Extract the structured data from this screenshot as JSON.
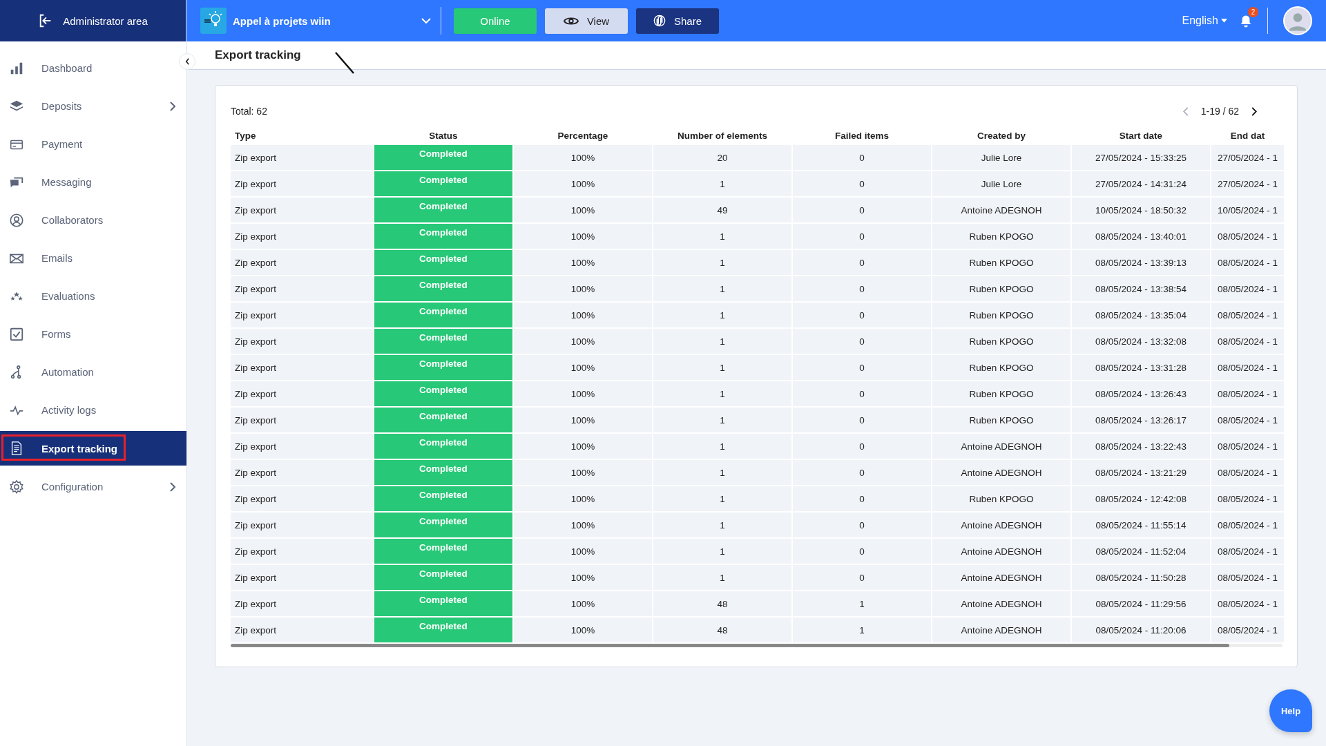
{
  "topbar": {
    "admin_label": "Administrator area",
    "project": {
      "name": "Appel à projets wiin"
    },
    "buttons": [
      {
        "label": "Online",
        "kind": "online"
      },
      {
        "label": "View",
        "kind": "view"
      },
      {
        "label": "Share",
        "kind": "share"
      }
    ],
    "language": "English",
    "notifications": "2"
  },
  "sidebar": {
    "items": [
      {
        "label": "Dashboard",
        "selected": false,
        "submenu": false
      },
      {
        "label": "Deposits",
        "selected": false,
        "submenu": true
      },
      {
        "label": "Payment",
        "selected": false,
        "submenu": false
      },
      {
        "label": "Messaging",
        "selected": false,
        "submenu": false
      },
      {
        "label": "Collaborators",
        "selected": false,
        "submenu": false
      },
      {
        "label": "Emails",
        "selected": false,
        "submenu": false
      },
      {
        "label": "Evaluations",
        "selected": false,
        "submenu": false
      },
      {
        "label": "Forms",
        "selected": false,
        "submenu": false
      },
      {
        "label": "Automation",
        "selected": false,
        "submenu": false
      },
      {
        "label": "Activity logs",
        "selected": false,
        "submenu": false
      },
      {
        "label": "Export tracking",
        "selected": true,
        "submenu": false
      },
      {
        "label": "Configuration",
        "selected": false,
        "submenu": true
      }
    ]
  },
  "page_title": "Export tracking",
  "total": "Total: 62",
  "pagination": "1-19 / 62",
  "help": "Help",
  "table": {
    "columns": [
      "Type",
      "Status",
      "Percentage",
      "Number of elements",
      "Failed items",
      "Created by",
      "Start date",
      "End dat"
    ],
    "rows": [
      [
        "Zip export",
        "Completed",
        "100%",
        "20",
        "0",
        "Julie Lore",
        "27/05/2024 - 15:33:25",
        "27/05/2024 - 1"
      ],
      [
        "Zip export",
        "Completed",
        "100%",
        "1",
        "0",
        "Julie Lore",
        "27/05/2024 - 14:31:24",
        "27/05/2024 - 1"
      ],
      [
        "Zip export",
        "Completed",
        "100%",
        "49",
        "0",
        "Antoine ADEGNOH",
        "10/05/2024 - 18:50:32",
        "10/05/2024 - 1"
      ],
      [
        "Zip export",
        "Completed",
        "100%",
        "1",
        "0",
        "Ruben KPOGO",
        "08/05/2024 - 13:40:01",
        "08/05/2024 - 1"
      ],
      [
        "Zip export",
        "Completed",
        "100%",
        "1",
        "0",
        "Ruben KPOGO",
        "08/05/2024 - 13:39:13",
        "08/05/2024 - 1"
      ],
      [
        "Zip export",
        "Completed",
        "100%",
        "1",
        "0",
        "Ruben KPOGO",
        "08/05/2024 - 13:38:54",
        "08/05/2024 - 1"
      ],
      [
        "Zip export",
        "Completed",
        "100%",
        "1",
        "0",
        "Ruben KPOGO",
        "08/05/2024 - 13:35:04",
        "08/05/2024 - 1"
      ],
      [
        "Zip export",
        "Completed",
        "100%",
        "1",
        "0",
        "Ruben KPOGO",
        "08/05/2024 - 13:32:08",
        "08/05/2024 - 1"
      ],
      [
        "Zip export",
        "Completed",
        "100%",
        "1",
        "0",
        "Ruben KPOGO",
        "08/05/2024 - 13:31:28",
        "08/05/2024 - 1"
      ],
      [
        "Zip export",
        "Completed",
        "100%",
        "1",
        "0",
        "Ruben KPOGO",
        "08/05/2024 - 13:26:43",
        "08/05/2024 - 1"
      ],
      [
        "Zip export",
        "Completed",
        "100%",
        "1",
        "0",
        "Ruben KPOGO",
        "08/05/2024 - 13:26:17",
        "08/05/2024 - 1"
      ],
      [
        "Zip export",
        "Completed",
        "100%",
        "1",
        "0",
        "Antoine ADEGNOH",
        "08/05/2024 - 13:22:43",
        "08/05/2024 - 1"
      ],
      [
        "Zip export",
        "Completed",
        "100%",
        "1",
        "0",
        "Antoine ADEGNOH",
        "08/05/2024 - 13:21:29",
        "08/05/2024 - 1"
      ],
      [
        "Zip export",
        "Completed",
        "100%",
        "1",
        "0",
        "Ruben KPOGO",
        "08/05/2024 - 12:42:08",
        "08/05/2024 - 1"
      ],
      [
        "Zip export",
        "Completed",
        "100%",
        "1",
        "0",
        "Antoine ADEGNOH",
        "08/05/2024 - 11:55:14",
        "08/05/2024 - 1"
      ],
      [
        "Zip export",
        "Completed",
        "100%",
        "1",
        "0",
        "Antoine ADEGNOH",
        "08/05/2024 - 11:52:04",
        "08/05/2024 - 1"
      ],
      [
        "Zip export",
        "Completed",
        "100%",
        "1",
        "0",
        "Antoine ADEGNOH",
        "08/05/2024 - 11:50:28",
        "08/05/2024 - 1"
      ],
      [
        "Zip export",
        "Completed",
        "100%",
        "48",
        "1",
        "Antoine ADEGNOH",
        "08/05/2024 - 11:29:56",
        "08/05/2024 - 1"
      ],
      [
        "Zip export",
        "Completed",
        "100%",
        "48",
        "1",
        "Antoine ADEGNOH",
        "08/05/2024 - 11:20:06",
        "08/05/2024 - 1"
      ]
    ]
  }
}
